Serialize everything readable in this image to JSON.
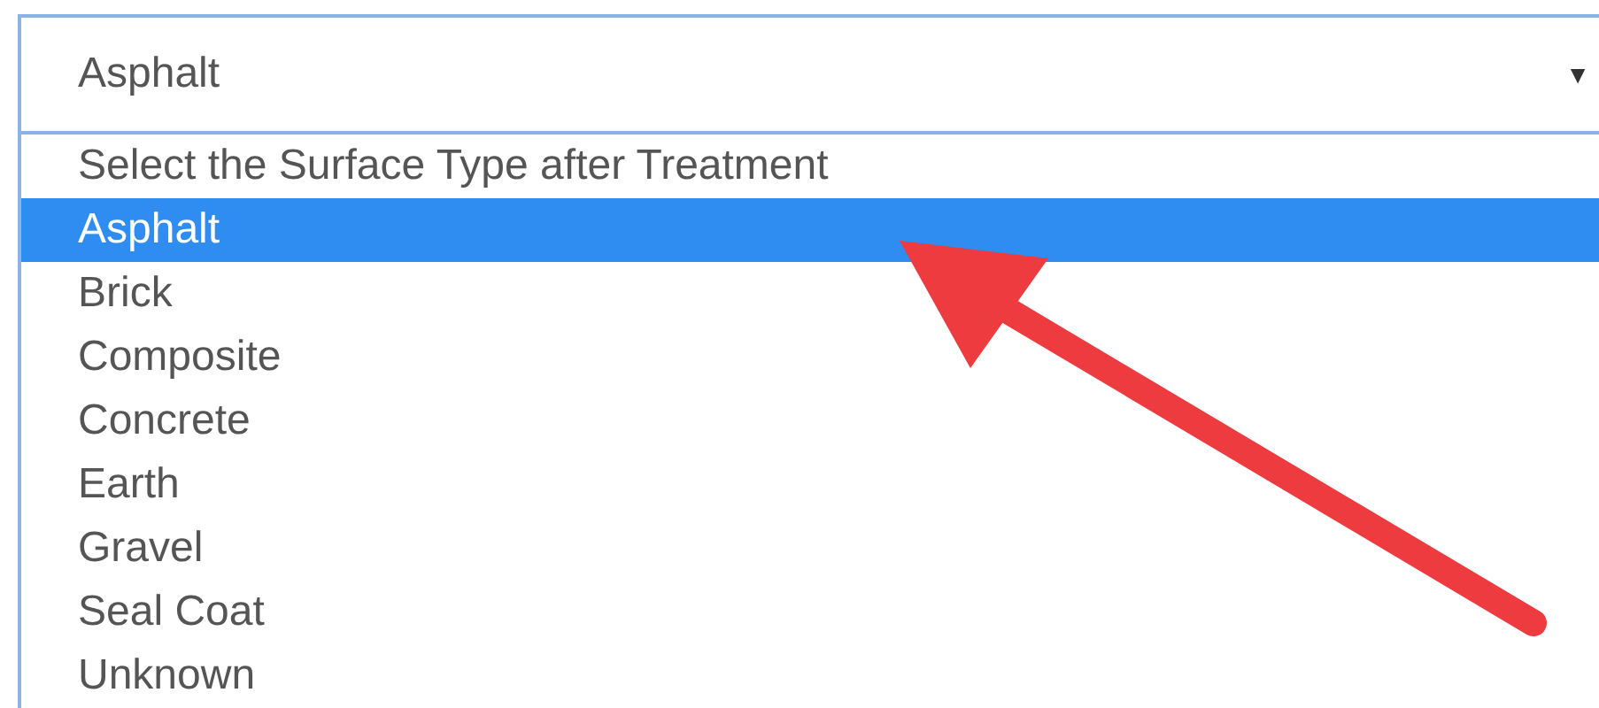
{
  "select": {
    "value": "Asphalt",
    "caret": "▼"
  },
  "options": [
    {
      "label": "Select the Surface Type after Treatment",
      "selected": false
    },
    {
      "label": "Asphalt",
      "selected": true
    },
    {
      "label": "Brick",
      "selected": false
    },
    {
      "label": "Composite",
      "selected": false
    },
    {
      "label": "Concrete",
      "selected": false
    },
    {
      "label": "Earth",
      "selected": false
    },
    {
      "label": "Gravel",
      "selected": false
    },
    {
      "label": "Seal Coat",
      "selected": false
    },
    {
      "label": "Unknown",
      "selected": false
    }
  ]
}
